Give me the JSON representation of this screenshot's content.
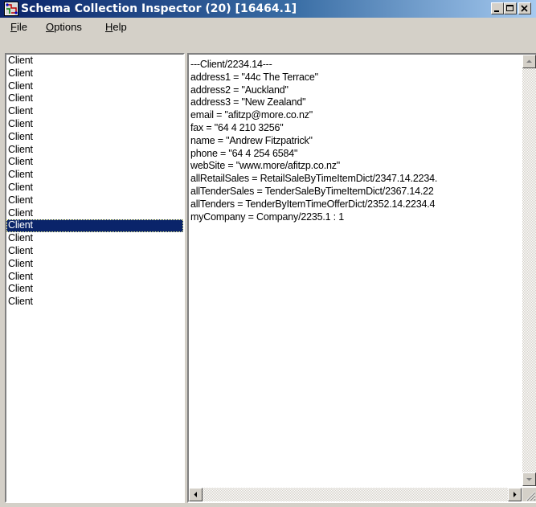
{
  "window": {
    "title": "Schema Collection Inspector (20) [16464.1]",
    "icon": "app-schema-icon",
    "controls": {
      "minimize": "minimize-icon",
      "maximize": "maximize-icon",
      "close": "close-icon"
    }
  },
  "menu": {
    "file": {
      "accel": "F",
      "rest": "ile"
    },
    "options": {
      "accel": "O",
      "rest": "ptions"
    },
    "help": {
      "accel": "H",
      "rest": "elp"
    }
  },
  "list": {
    "items": [
      "Client",
      "Client",
      "Client",
      "Client",
      "Client",
      "Client",
      "Client",
      "Client",
      "Client",
      "Client",
      "Client",
      "Client",
      "Client",
      "Client",
      "Client",
      "Client",
      "Client",
      "Client",
      "Client",
      "Client"
    ],
    "selected_index": 13
  },
  "detail": {
    "lines": [
      "---Client/2234.14---",
      "address1 = \"44c The Terrace\"",
      "address2 = \"Auckland\"",
      "address3 = \"New Zealand\"",
      "email = \"afitzp@more.co.nz\"",
      "fax = \"64 4 210 3256\"",
      "name = \"Andrew  Fitzpatrick\"",
      "phone = \"64 4 254 6584\"",
      "webSite = \"www.more/afitzp.co.nz\"",
      "allRetailSales = RetailSaleByTimeItemDict/2347.14.2234.",
      "allTenderSales = TenderSaleByTimeItemDict/2367.14.22",
      "allTenders = TenderByItemTimeOfferDict/2352.14.2234.4",
      "myCompany = Company/2235.1 : 1"
    ]
  },
  "colors": {
    "title_start": "#0a246a",
    "title_end": "#a6caf0",
    "selection": "#0a246a",
    "face": "#d4d0c8"
  }
}
